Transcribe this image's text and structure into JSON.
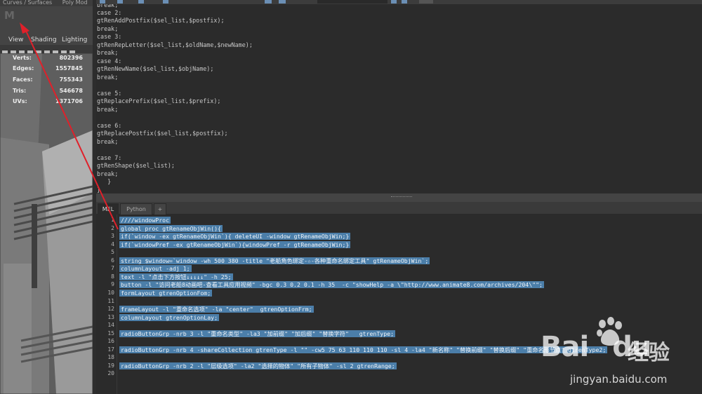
{
  "left_panel": {
    "top_menu": [
      "Curves / Surfaces",
      "Poly Mod"
    ],
    "logo": "M",
    "viewport_menu": [
      "View",
      "Shading",
      "Lighting"
    ],
    "hud": [
      {
        "label": "Verts:",
        "value": "802396"
      },
      {
        "label": "Edges:",
        "value": "1557845"
      },
      {
        "label": "Faces:",
        "value": "755343"
      },
      {
        "label": "Tris:",
        "value": "546678"
      },
      {
        "label": "UVs:",
        "value": "1371706"
      }
    ]
  },
  "history": {
    "lines": [
      "break;",
      "case 2:",
      "gtRenAddPostfix($sel_list,$postfix);",
      "break;",
      "case 3:",
      "gtRenRepLetter($sel_list,$oldName,$newName);",
      "break;",
      "case 4:",
      "gtRenNewName($sel_list,$objName);",
      "break;",
      "",
      "case 5:",
      "gtReplacePrefix($sel_list,$prefix);",
      "break;",
      "",
      "case 6:",
      "gtReplacePostfix($sel_list,$postfix);",
      "break;",
      "",
      "case 7:",
      "gtRenShape($sel_list);",
      "break;",
      "   }",
      "}"
    ]
  },
  "tabs": [
    {
      "label": "MEL",
      "active": true
    },
    {
      "label": "Python",
      "active": false
    },
    {
      "label": "+",
      "active": false
    }
  ],
  "editor": {
    "line_numbers": [
      "1",
      "2",
      "3",
      "4",
      "5",
      "6",
      "7",
      "8",
      "9",
      "10",
      "11",
      "12",
      "13",
      "14",
      "15",
      "16",
      "17",
      "18",
      "19",
      "20"
    ],
    "lines": [
      "////windowProc",
      "global proc gtRenameObjWin(){",
      "if(`window -ex gtRenameObjWin`){ deleteUI -window gtRenameObjWin;}",
      "if(`windowPref -ex gtRenameObjWin`){windowPref -r gtRenameObjWin;}",
      "",
      "string $window=`window -wh 500 380 -title \"老船角色绑定-☆-各种重命名绑定工具\" gtRenameObjWin`;",
      "columnLayout -adj 1;",
      "text -l \"点击下方按钮↓↓↓↓↓\" -h 25;",
      "button -l \"访问老船8动画吧-查看工具应用视频\" -bgc 0.3 0.2 0.1 -h 35  -c \"showHelp -a \\\"http://www.animate8.com/archives/204\\\"\";",
      "formLayout gtrenOptionFom;",
      "",
      "frameLayout -l \"重命名选项\" -la \"center\"  gtrenOptionFrm;",
      "columnLayout gtrenOptionLay;",
      "",
      "radioButtonGrp -nrb 3 -l \"重命名类型\" -la3 \"加前缀\" \"加后缀\" \"替换字符\"   gtrenType;",
      "",
      "radioButtonGrp -nrb 4 -shareCollection gtrenType -l \"\" -cw5 75 63 110 110 110 -sl 4 -la4 \"新名称\" \"替换前缀\" \"替换后缀\" \"重命名形节点\" gtrenType2;",
      "",
      "radioButtonGrp -nrb 2 -l \"层级选项\" -la2 \"选择的物体\" \"所有子物体\" -sl 2 gtrenRange;",
      ""
    ]
  },
  "watermark": {
    "brand": "Bai",
    "brand_suffix": "du",
    "cn": "经验",
    "url": "jingyan.baidu.com"
  }
}
